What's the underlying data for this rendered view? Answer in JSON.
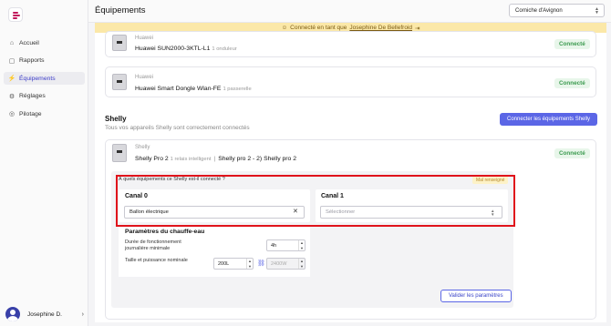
{
  "sidebar": {
    "items": [
      {
        "label": "Accueil",
        "icon": "home-icon"
      },
      {
        "label": "Rapports",
        "icon": "report-icon"
      },
      {
        "label": "Équipements",
        "icon": "plug-icon"
      },
      {
        "label": "Réglages",
        "icon": "gear-icon"
      },
      {
        "label": "Pilotage",
        "icon": "target-icon"
      }
    ],
    "active_index": 2,
    "user_name": "Josephine D."
  },
  "header": {
    "title": "Équipements",
    "site_select": "Corniche d'Avignon"
  },
  "banner": {
    "text": "Connecté en tant que",
    "user_link": "Josephine De Bellefroid"
  },
  "devices": [
    {
      "brand": "Huawei",
      "name": "Huawei SUN2000-3KTL-L1",
      "sub": "1 onduleur",
      "status": "Connecté"
    },
    {
      "brand": "Huawei",
      "name": "Huawei Smart Dongle Wlan-FE",
      "sub": "1 passerelle",
      "status": "Connecté"
    }
  ],
  "shelly": {
    "title": "Shelly",
    "subtitle": "Tous vos appareils Shelly sont correctement connectés",
    "connect_button": "Connecter les équipements Shelly",
    "device": {
      "brand": "Shelly",
      "name": "Shelly Pro 2",
      "sub": "1 relais intelligent",
      "alias": "Shelly pro 2 - 2) Shelly pro 2",
      "status": "Connecté"
    },
    "question": "À quels équipements ce Shelly est-il connecté ?",
    "warn_badge": "Mal renseigné",
    "channels": [
      {
        "label": "Canal 0",
        "value": "Ballon électrique"
      },
      {
        "label": "Canal 1",
        "placeholder": "Sélectionner"
      }
    ],
    "params": {
      "title": "Paramètres du chauffe-eau",
      "duration_label": "Durée de fonctionnement journalière minimale",
      "duration_value": "4h",
      "size_label": "Taille et puissance nominale",
      "size_value": "200L",
      "power_value": "2400W",
      "validate_button": "Valider les paramètres"
    }
  },
  "colors": {
    "accent": "#5b66e6",
    "success": "#3a9a4e",
    "highlight": "#e0131b",
    "banner": "#fbe8a8"
  }
}
